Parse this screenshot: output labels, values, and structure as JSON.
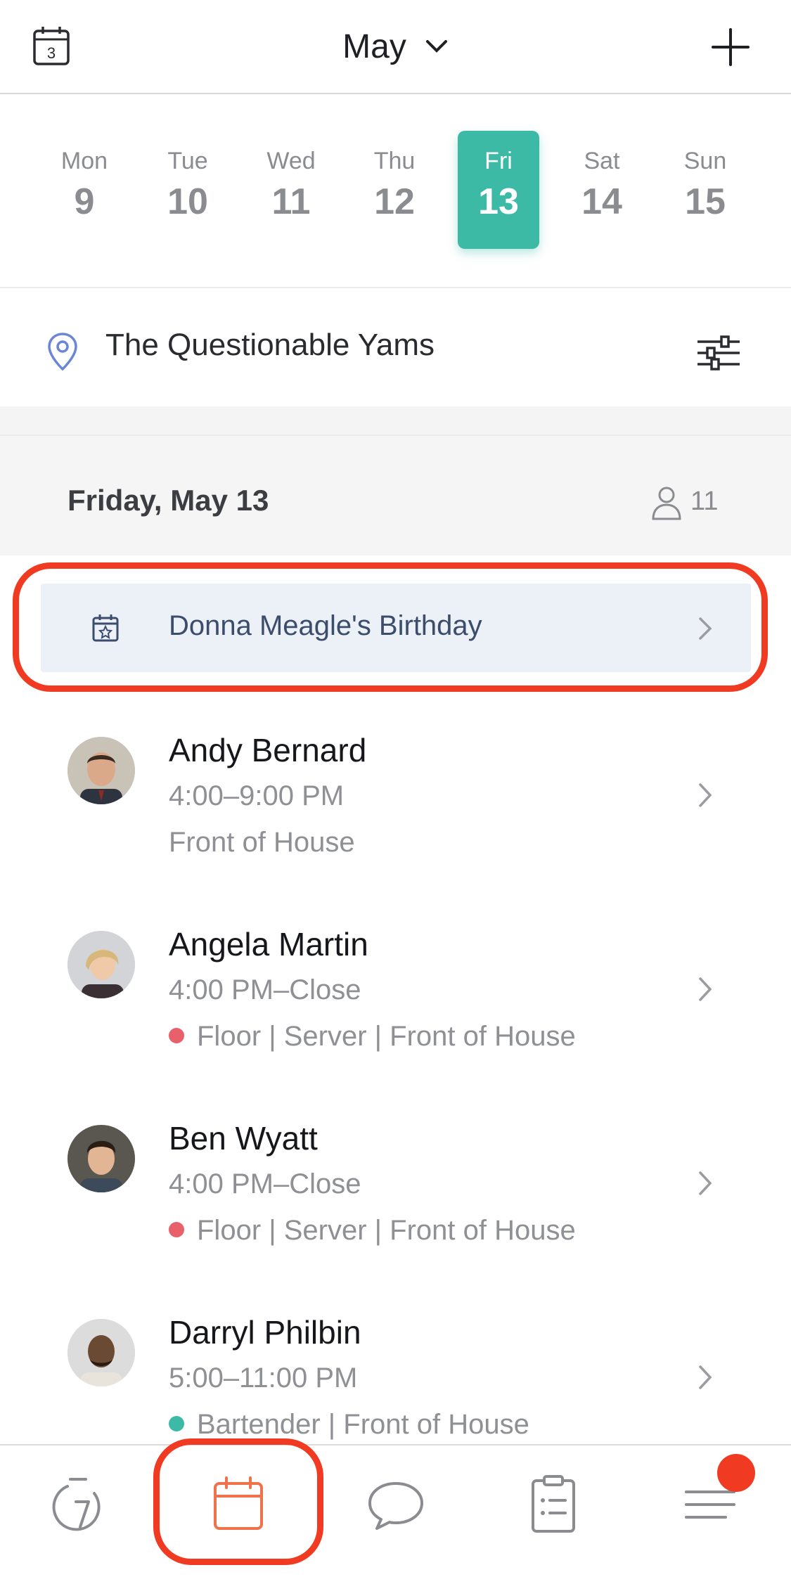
{
  "header": {
    "calendar_icon_day": "3",
    "month": "May",
    "month_dropdown_icon": "chevron-down-icon",
    "add_icon": "plus-icon"
  },
  "week": {
    "days": [
      {
        "name": "Mon",
        "date": "9",
        "selected": false
      },
      {
        "name": "Tue",
        "date": "10",
        "selected": false
      },
      {
        "name": "Wed",
        "date": "11",
        "selected": false
      },
      {
        "name": "Thu",
        "date": "12",
        "selected": false
      },
      {
        "name": "Fri",
        "date": "13",
        "selected": true
      },
      {
        "name": "Sat",
        "date": "14",
        "selected": false
      },
      {
        "name": "Sun",
        "date": "15",
        "selected": false
      }
    ],
    "accent_color": "#3dbaa6"
  },
  "location": {
    "name": "The Questionable Yams",
    "pin_icon": "location-pin-icon",
    "filter_icon": "sliders-icon"
  },
  "day_section": {
    "title": "Friday, May 13",
    "count": "11"
  },
  "event": {
    "label": "Donna Meagle's Birthday",
    "icon": "calendar-star-icon"
  },
  "shifts": [
    {
      "name": "Andy Bernard",
      "time": "4:00–9:00 PM",
      "role": "Front of House",
      "dot_color": null
    },
    {
      "name": "Angela Martin",
      "time": "4:00 PM–Close",
      "role": "Floor | Server | Front of House",
      "dot_color": "#e8606a"
    },
    {
      "name": "Ben Wyatt",
      "time": "4:00 PM–Close",
      "role": "Floor | Server | Front of House",
      "dot_color": "#e8606a"
    },
    {
      "name": "Darryl Philbin",
      "time": "5:00–11:00 PM",
      "role": "Bartender | Front of House",
      "dot_color": "#3dbaa6"
    }
  ],
  "nav": {
    "items": [
      "timer-icon",
      "calendar-icon",
      "chat-icon",
      "clipboard-icon",
      "menu-icon"
    ],
    "active": "calendar-icon",
    "active_color": "#f0724a",
    "badge_color": "#f03b22"
  },
  "annotation_color": "#f03b22"
}
